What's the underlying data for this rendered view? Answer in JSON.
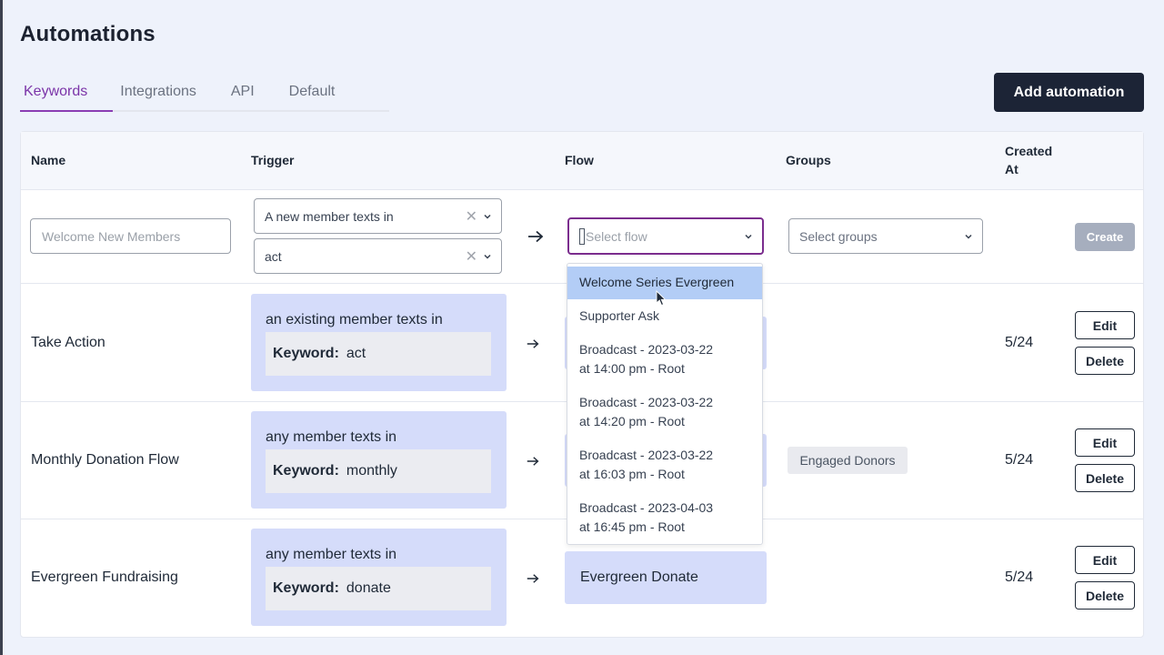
{
  "page": {
    "title": "Automations"
  },
  "tabs": [
    "Keywords",
    "Integrations",
    "API",
    "Default"
  ],
  "actions": {
    "add_automation": "Add automation"
  },
  "table": {
    "headers": {
      "name": "Name",
      "trigger": "Trigger",
      "flow": "Flow",
      "groups": "Groups",
      "created_line1": "Created",
      "created_line2": "At"
    }
  },
  "new_row": {
    "name_placeholder": "Welcome New Members",
    "trigger_type": "A new member texts in",
    "trigger_keyword": "act",
    "flow_placeholder": "Select flow",
    "groups_placeholder": "Select groups",
    "create_label": "Create"
  },
  "rows": [
    {
      "name": "Take Action",
      "trigger": "an existing member texts in",
      "keyword_label": "Keyword:",
      "keyword": "act",
      "created": "5/24",
      "edit": "Edit",
      "delete": "Delete"
    },
    {
      "name": "Monthly Donation Flow",
      "trigger": "any member texts in",
      "keyword_label": "Keyword:",
      "keyword": "monthly",
      "group": "Engaged Donors",
      "created": "5/24",
      "edit": "Edit",
      "delete": "Delete"
    },
    {
      "name": "Evergreen Fundraising",
      "trigger": "any member texts in",
      "keyword_label": "Keyword:",
      "keyword": "donate",
      "flow": "Evergreen Donate",
      "created": "5/24",
      "edit": "Edit",
      "delete": "Delete"
    }
  ],
  "flow_dropdown": {
    "options": [
      {
        "line1": "Welcome Series Evergreen"
      },
      {
        "line1": "Supporter Ask"
      },
      {
        "line1": "Broadcast - 2023-03-22",
        "line2": "at 14:00 pm - Root"
      },
      {
        "line1": "Broadcast - 2023-03-22",
        "line2": "at 14:20 pm - Root"
      },
      {
        "line1": "Broadcast - 2023-03-22",
        "line2": "at 16:03 pm - Root"
      },
      {
        "line1": "Broadcast - 2023-04-03",
        "line2": "at 16:45 pm - Root"
      }
    ],
    "highlighted_index": 0
  },
  "colors": {
    "accent": "#7b34a8",
    "primary_button": "#1c2436",
    "card_blue": "#d5dcfa",
    "highlight": "#b3cdf6"
  }
}
